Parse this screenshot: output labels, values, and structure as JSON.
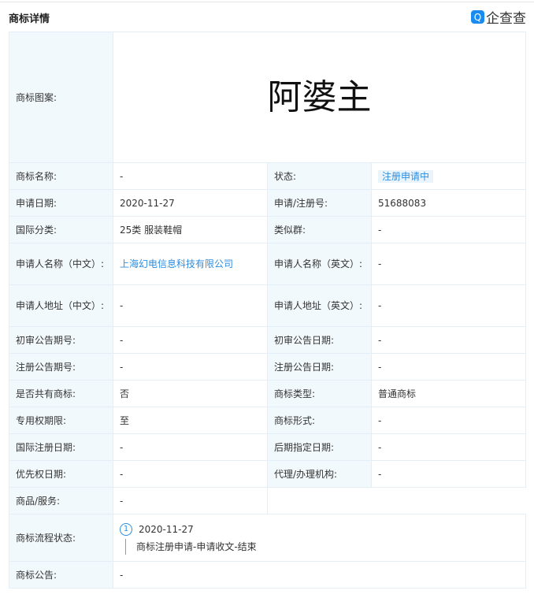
{
  "header": {
    "title": "商标详情",
    "logo_text": "企查查",
    "logo_mark": "Q"
  },
  "image": {
    "label": "商标图案:",
    "mark_text": "阿婆主"
  },
  "rows": [
    {
      "l1": "商标名称:",
      "v1": "-",
      "l2": "状态:",
      "v2": "注册申请中"
    },
    {
      "l1": "申请日期:",
      "v1": "2020-11-27",
      "l2": "申请/注册号:",
      "v2": "51688083"
    },
    {
      "l1": "国际分类:",
      "v1": "25类 服装鞋帽",
      "l2": "类似群:",
      "v2": "-"
    },
    {
      "l1": "申请人名称（中文）:",
      "v1": "上海幻电信息科技有限公司",
      "l2": "申请人名称（英文）:",
      "v2": "-"
    },
    {
      "l1": "申请人地址（中文）:",
      "v1": "-",
      "l2": "申请人地址（英文）:",
      "v2": "-"
    },
    {
      "l1": "初审公告期号:",
      "v1": "-",
      "l2": "初审公告日期:",
      "v2": "-"
    },
    {
      "l1": "注册公告期号:",
      "v1": "-",
      "l2": "注册公告日期:",
      "v2": "-"
    },
    {
      "l1": "是否共有商标:",
      "v1": "否",
      "l2": "商标类型:",
      "v2": "普通商标"
    },
    {
      "l1": "专用权期限:",
      "v1": "至",
      "l2": "商标形式:",
      "v2": "-"
    },
    {
      "l1": "国际注册日期:",
      "v1": "-",
      "l2": "后期指定日期:",
      "v2": "-"
    },
    {
      "l1": "优先权日期:",
      "v1": "-",
      "l2": "代理/办理机构:",
      "v2": "-"
    }
  ],
  "goods": {
    "label": "商品/服务:",
    "value": "-"
  },
  "flow": {
    "label": "商标流程状态:",
    "steps": [
      {
        "num": "1",
        "date": "2020-11-27",
        "desc": "商标注册申请-申请收文-结束"
      }
    ]
  },
  "notice": {
    "label": "商标公告:",
    "value": "-"
  }
}
